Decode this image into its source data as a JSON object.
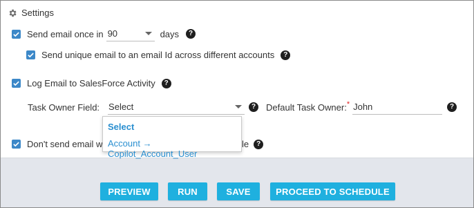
{
  "settings": {
    "title": "Settings",
    "send_email_once": {
      "label_prefix": "Send email once in",
      "value": "90",
      "label_suffix": "days",
      "checked": true
    },
    "send_unique_email": {
      "label": "Send unique email to an email Id across different accounts",
      "checked": true
    },
    "log_email": {
      "label": "Log Email to SalesForce Activity",
      "checked": true
    },
    "task_owner_field": {
      "label": "Task Owner Field:",
      "value": "Select"
    },
    "default_task_owner": {
      "label": "Default Task Owner:",
      "required_mark": "*",
      "value": "John"
    },
    "dont_send": {
      "label_visible_start": "Don't send email wh",
      "label_visible_end": "le",
      "checked": true
    },
    "dropdown": {
      "options": [
        "Select",
        "Account → Copilot_Account_User"
      ]
    }
  },
  "footer": {
    "buttons": {
      "preview": "PREVIEW",
      "run": "RUN",
      "save": "SAVE",
      "proceed": "PROCEED TO SCHEDULE"
    }
  },
  "colors": {
    "checkbox": "#3c88c8",
    "button": "#1fb0df",
    "link": "#2a8fd0",
    "required": "#e02020",
    "footer_bg": "#e3e6ec"
  }
}
